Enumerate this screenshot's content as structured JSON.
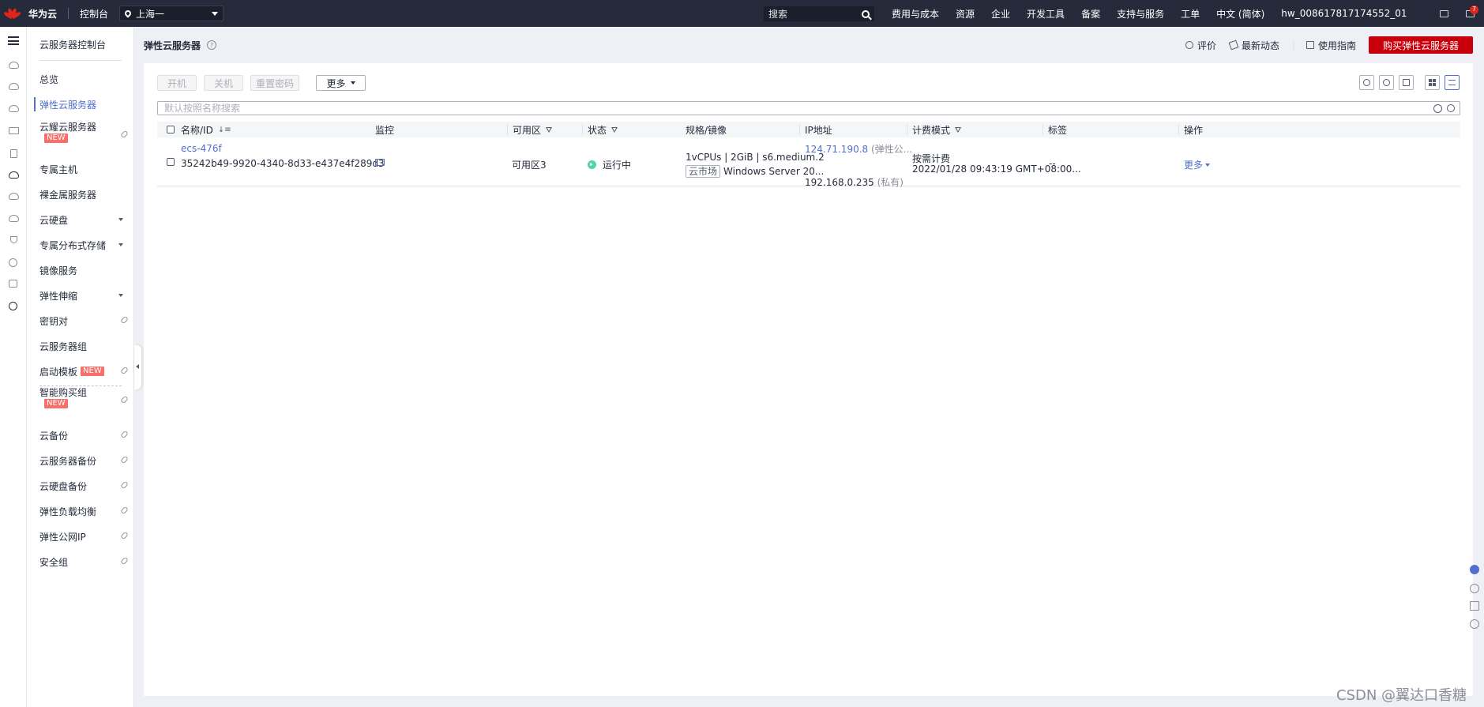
{
  "topbar": {
    "brand": "华为云",
    "console": "控制台",
    "region": "上海一",
    "search_placeholder": "搜索",
    "nav": [
      "费用与成本",
      "资源",
      "企业",
      "开发工具",
      "备案",
      "支持与服务",
      "工单",
      "中文 (简体)",
      "hw_008617817174552_01"
    ],
    "msg_count": "7"
  },
  "sidebar": {
    "title": "云服务器控制台",
    "items": [
      {
        "label": "总览"
      },
      {
        "label": "弹性云服务器",
        "active": true
      },
      {
        "label": "云耀云服务器",
        "badge": "NEW"
      },
      {
        "label": "专属主机"
      },
      {
        "label": "裸金属服务器"
      },
      {
        "label": "云硬盘"
      },
      {
        "label": "专属分布式存储"
      },
      {
        "label": "镜像服务"
      },
      {
        "label": "弹性伸缩"
      },
      {
        "label": "密钥对"
      },
      {
        "label": "云服务器组"
      },
      {
        "label": "启动模板",
        "badge": "NEW"
      },
      {
        "label": "智能购买组",
        "badge": "NEW"
      },
      {
        "label": "云备份"
      },
      {
        "label": "云服务器备份"
      },
      {
        "label": "云硬盘备份"
      },
      {
        "label": "弹性负载均衡"
      },
      {
        "label": "弹性公网IP"
      },
      {
        "label": "安全组"
      }
    ]
  },
  "header": {
    "title": "弹性云服务器",
    "rate": "评价",
    "news": "最新动态",
    "guide": "使用指南",
    "buy": "购买弹性云服务器"
  },
  "toolbar": {
    "start": "开机",
    "stop": "关机",
    "reset_pwd": "重置密码",
    "more": "更多"
  },
  "search": {
    "placeholder": "默认按照名称搜索"
  },
  "table": {
    "columns": [
      "名称/ID",
      "监控",
      "可用区",
      "状态",
      "规格/镜像",
      "IP地址",
      "计费模式",
      "标签",
      "操作"
    ],
    "rows": [
      {
        "name": "ecs-476f",
        "id": "35242b49-9920-4340-8d33-e437e4f289d3",
        "zone": "可用区3",
        "status": "运行中",
        "spec": "1vCPUs | 2GiB | s6.medium.2",
        "image_tag": "云市场",
        "image": "Windows Server 20...",
        "public_ip": "124.71.190.8",
        "public_ip_note": "(弹性公...",
        "private_ip": "192.168.0.235",
        "private_ip_note": "(私有)",
        "billing": "按需计费",
        "billing_time": "2022/01/28 09:43:19 GMT+08:00...",
        "tags": "--",
        "action": "更多"
      }
    ]
  },
  "watermark": "CSDN @翼达口香糖",
  "colors": {
    "topbar": "#252b3a",
    "accent": "#526ecc",
    "buy_button": "#c7000b",
    "running": "#50d4ab",
    "badge_new": "#f66f6a"
  }
}
